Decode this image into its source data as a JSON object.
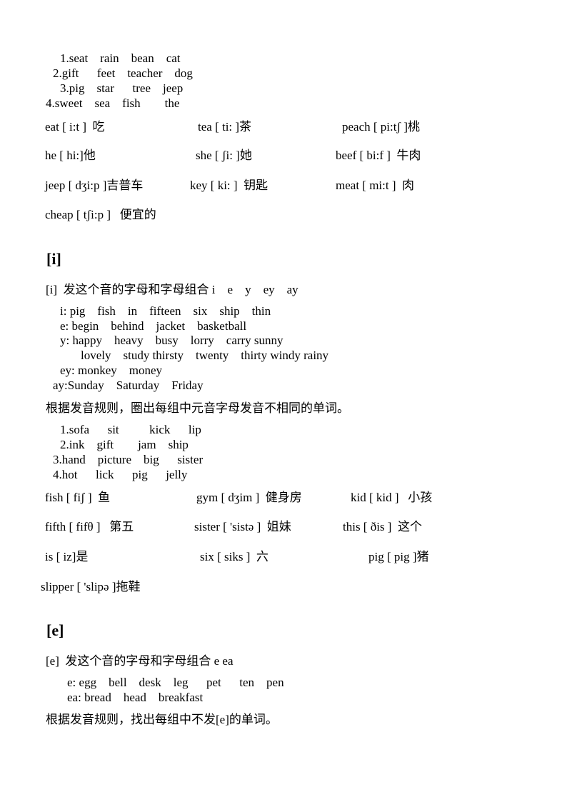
{
  "group1": [
    "1.seat    rain    bean    cat",
    "2.gift      feet    teacher    dog",
    "3.pig    star      tree    jeep",
    "4.sweet    sea    fish        the"
  ],
  "vocab1": [
    [
      "eat [ i:t ]  吃",
      "tea [ ti: ]茶",
      "peach [ pi:tʃ ]桃"
    ],
    [
      "he [ hi:]他",
      "she [ ʃi: ]她",
      "beef [ bi:f ]  牛肉"
    ],
    [
      "jeep [ dʒi:p ]吉普车",
      "key [ ki: ]  钥匙",
      "meat [ mi:t ]  肉"
    ],
    [
      "cheap [ tʃi:p ]   便宜的"
    ]
  ],
  "section_i": {
    "heading": "[i]",
    "intro": "[i]  发这个音的字母和字母组合 i    e    y    ey    ay",
    "examples": [
      "i: pig    fish    in    fifteen    six    ship    thin",
      "e: begin    behind    jacket    basketball",
      "y: happy    heavy    busy    lorry    carry sunny",
      "lovely    study thirsty    twenty    thirty windy rainy",
      "ey: monkey    money",
      "ay:Sunday    Saturday    Friday"
    ],
    "instruction": "根据发音规则，圈出每组中元音字母发音不相同的单词。",
    "groups": [
      "1.sofa      sit          kick      lip",
      "2.ink    gift        jam    ship",
      "3.hand    picture    big      sister",
      "4.hot      lick      pig      jelly"
    ],
    "vocab": [
      [
        "fish [ fiʃ ]  鱼",
        "gym [ dʒim ]  健身房",
        "kid [ kid ]   小孩"
      ],
      [
        "fifth [ fifθ ]   第五",
        "sister [ 'sistə ]  姐妹",
        "this [ ðis ]  这个"
      ],
      [
        "is [ iz]是",
        "six [ siks ]  六",
        "pig [ pig ]猪"
      ],
      [
        "slipper [ 'slipə ]拖鞋"
      ]
    ]
  },
  "section_e": {
    "heading": "[e]",
    "intro": "[e]  发这个音的字母和字母组合 e ea",
    "examples": [
      "e: egg    bell    desk    leg      pet      ten    pen",
      "ea: bread    head    breakfast"
    ],
    "instruction": "根据发音规则，找出每组中不发[e]的单词。"
  }
}
